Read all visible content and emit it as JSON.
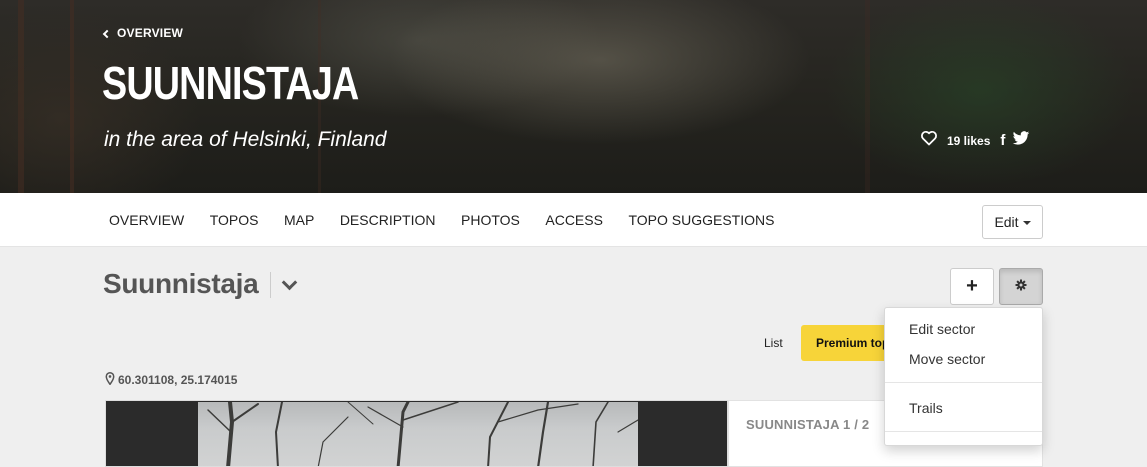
{
  "hero": {
    "back_label": "OVERVIEW",
    "title": "SUUNNISTAJA",
    "subtitle": "in the area of Helsinki, Finland",
    "likes": "19 likes",
    "facebook_glyph": "f"
  },
  "nav": {
    "items": [
      "OVERVIEW",
      "TOPOS",
      "MAP",
      "DESCRIPTION",
      "PHOTOS",
      "ACCESS",
      "TOPO SUGGESTIONS"
    ],
    "edit_label": "Edit"
  },
  "sector": {
    "title": "Suunnistaja",
    "add_glyph": "+",
    "coords": "60.301108, 25.174015",
    "topo_count": "SUUNNISTAJA 1 / 2"
  },
  "view_toggle": {
    "list_label": "List",
    "premium_label": "Premium topos"
  },
  "settings_menu": {
    "items": [
      "Edit sector",
      "Move sector",
      "Trails"
    ]
  },
  "colors": {
    "premium_yellow": "#f7d439",
    "hero_dark": "#25241f",
    "page_bg": "#efefef"
  },
  "icons": [
    "chevron-left-icon",
    "heart-icon",
    "facebook-icon",
    "twitter-icon",
    "chevron-down-icon",
    "plus-icon",
    "gear-icon",
    "map-pin-icon"
  ]
}
